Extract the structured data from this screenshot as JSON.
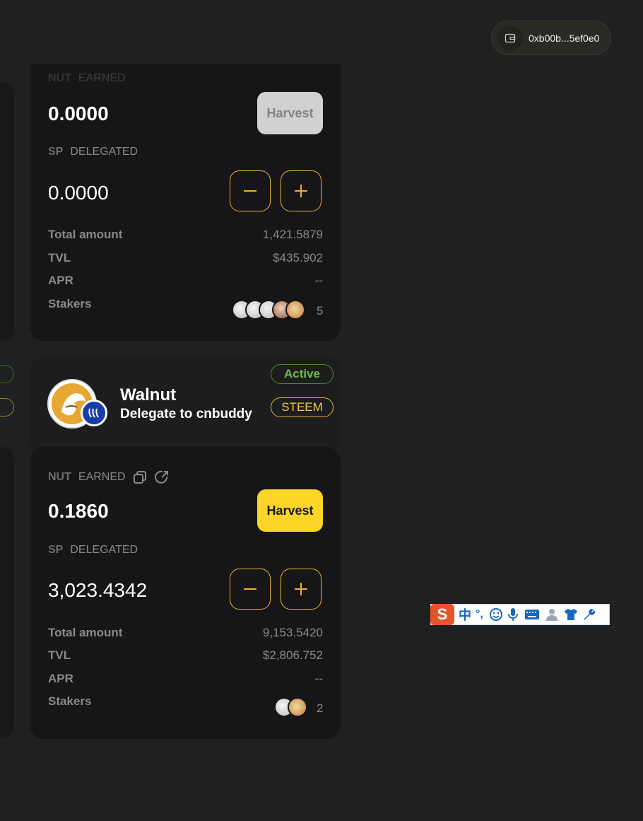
{
  "wallet": {
    "address": "0xb00b...5ef0e0",
    "icon": "wallet-icon"
  },
  "pool_top": {
    "earned_token": "NUT",
    "earned_label": "EARNED",
    "earned_value": "0.0000",
    "harvest_label": "Harvest",
    "delegated_token": "SP",
    "delegated_label": "DELEGATED",
    "delegated_value": "0.0000",
    "stats": [
      {
        "label": "Total amount",
        "value": "1,421.5879"
      },
      {
        "label": "TVL",
        "value": "$435.902"
      },
      {
        "label": "APR",
        "value": "--"
      },
      {
        "label": "Stakers",
        "value": "5"
      }
    ]
  },
  "pool_walnut": {
    "name": "Walnut",
    "subtitle": "Delegate to cnbuddy",
    "status_badge": "Active",
    "chain_badge": "STEEM",
    "earned_token": "NUT",
    "earned_label": "EARNED",
    "earned_value": "0.1860",
    "harvest_label": "Harvest",
    "delegated_token": "SP",
    "delegated_label": "DELEGATED",
    "delegated_value": "3,023.4342",
    "stats": [
      {
        "label": "Total amount",
        "value": "9,153.5420"
      },
      {
        "label": "TVL",
        "value": "$2,806.752"
      },
      {
        "label": "APR",
        "value": "--"
      },
      {
        "label": "Stakers",
        "value": "2"
      }
    ]
  },
  "ime_toolbar": {
    "logo": "S",
    "mode": "中",
    "punct": "°,",
    "icons": [
      "emoji-icon",
      "microphone-icon",
      "keyboard-icon",
      "user-icon",
      "shirt-icon",
      "wrench-icon"
    ]
  },
  "colors": {
    "accent_yellow": "#fbd626",
    "outline_gold": "#e6b431",
    "active_green": "#6cc04a",
    "disabled_harvest": "#d1d1d1",
    "page_bg": "#1f2022",
    "card_bg": "#161618"
  }
}
